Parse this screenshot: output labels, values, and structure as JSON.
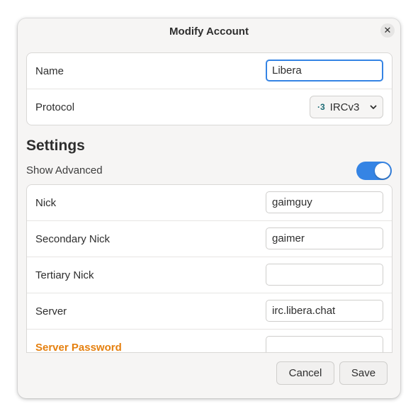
{
  "dialog": {
    "title": "Modify Account",
    "close_glyph": "✕"
  },
  "account": {
    "name_label": "Name",
    "name_value": "Libera",
    "protocol_label": "Protocol",
    "protocol_icon_text": "·3",
    "protocol_value": "IRCv3"
  },
  "settings": {
    "title": "Settings",
    "show_advanced_label": "Show Advanced",
    "show_advanced_on": true,
    "rows": [
      {
        "label": "Nick",
        "value": "gaimguy"
      },
      {
        "label": "Secondary Nick",
        "value": "gaimer"
      },
      {
        "label": "Tertiary Nick",
        "value": ""
      },
      {
        "label": "Server",
        "value": "irc.libera.chat"
      },
      {
        "label": "Server Password",
        "value": ""
      }
    ]
  },
  "footer": {
    "cancel_label": "Cancel",
    "save_label": "Save"
  },
  "colors": {
    "accent": "#3584e4",
    "warning": "#e5800f",
    "dialog_bg": "#f6f5f4"
  }
}
